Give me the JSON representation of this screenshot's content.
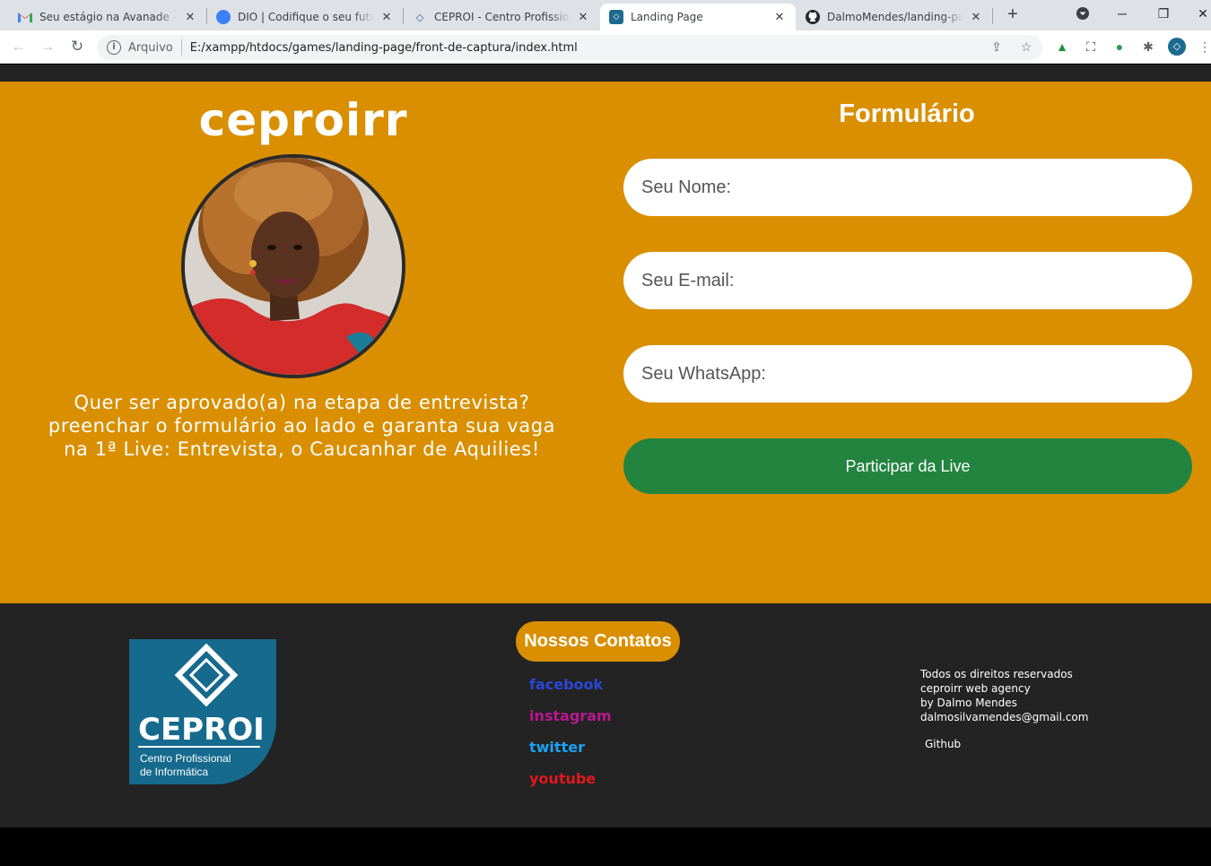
{
  "browser": {
    "tabs": [
      {
        "title": "Seu estágio na Avanade - dalmo",
        "favicon": "gmail-icon"
      },
      {
        "title": "DIO | Codifique o seu futuro g",
        "favicon": "dio-icon"
      },
      {
        "title": "CEPROI - Centro Profissional d",
        "favicon": "ceproi-icon"
      },
      {
        "title": "Landing Page",
        "favicon": "ceproi-icon"
      },
      {
        "title": "DalmoMendes/landing-page",
        "favicon": "github-icon"
      }
    ],
    "active_tab_index": 3,
    "address": {
      "scheme_label": "Arquivo",
      "url": "E:/xampp/htdocs/games/landing-page/front-de-captura/index.html"
    }
  },
  "hero": {
    "brand": "ceproirr",
    "portrait_alt": "Mulher de cabelo cacheado e blusa vermelha",
    "lead_lines": [
      "Quer ser aprovado(a) na etapa de entrevista?",
      "preenchar o formulário ao lado e garanta sua vaga",
      "na 1ª Live: Entrevista, o Caucanhar de Aquilies!"
    ]
  },
  "form": {
    "title": "Formulário",
    "name_placeholder": "Seu Nome:",
    "email_placeholder": "Seu E-mail:",
    "whatsapp_placeholder": "Seu WhatsApp:",
    "submit_label": "Participar da Live"
  },
  "footer": {
    "logo": {
      "name": "CEPROI",
      "subtitle_line1": "Centro Profissional",
      "subtitle_line2": "de Informática"
    },
    "contacts_title": "Nossos Contatos",
    "links": [
      {
        "label": "facebook",
        "color": "#2a47d6"
      },
      {
        "label": "instagram",
        "color": "#b8188f"
      },
      {
        "label": "twitter",
        "color": "#1da1f2"
      },
      {
        "label": "youtube",
        "color": "#e0191b"
      }
    ],
    "rights_lines": [
      "Todos os direitos reservados",
      "ceproirr web agency",
      "by Dalmo Mendes",
      "dalmosilvamendes@gmail.com"
    ],
    "github_label": "Github"
  },
  "colors": {
    "hero_bg": "#d98f00",
    "footer_bg": "#232323",
    "button_green": "#22843f"
  }
}
